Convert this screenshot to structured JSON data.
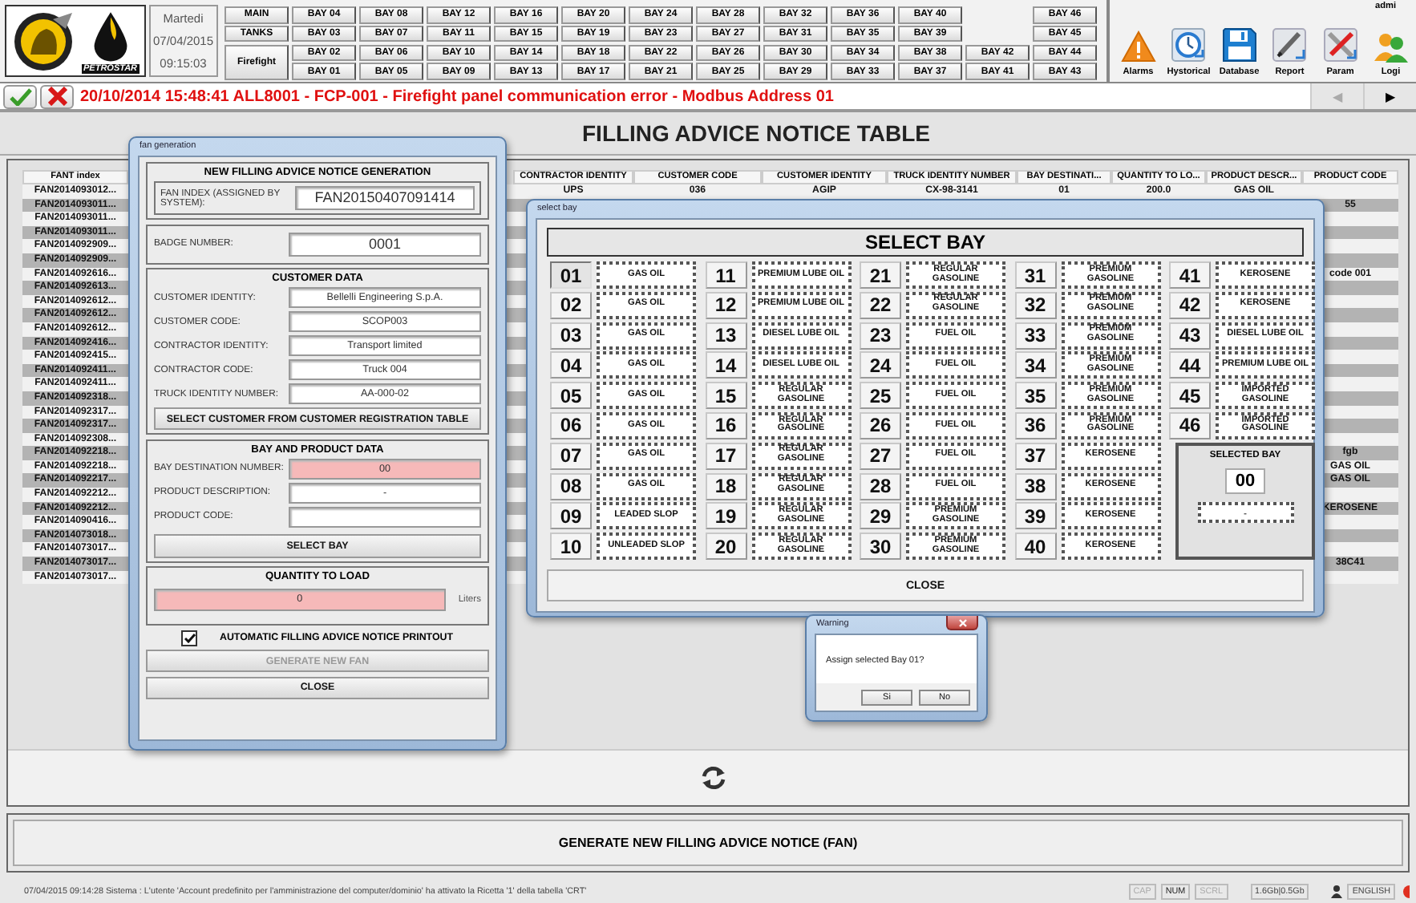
{
  "header": {
    "logo_text": "PETROSTAR",
    "day": "Martedi",
    "date": "07/04/2015",
    "time": "09:15:03",
    "nav_left": [
      "MAIN",
      "TANKS",
      "Firefight"
    ],
    "bay_rows": [
      [
        "BAY 04",
        "BAY 08",
        "BAY 12",
        "BAY 16",
        "BAY 20",
        "BAY 24",
        "BAY 28",
        "BAY 32",
        "BAY 36",
        "BAY 40",
        null,
        "BAY 46"
      ],
      [
        "BAY 03",
        "BAY 07",
        "BAY 11",
        "BAY 15",
        "BAY 19",
        "BAY 23",
        "BAY 27",
        "BAY 31",
        "BAY 35",
        "BAY 39",
        null,
        "BAY 45"
      ],
      [
        "BAY 02",
        "BAY 06",
        "BAY 10",
        "BAY 14",
        "BAY 18",
        "BAY 22",
        "BAY 26",
        "BAY 30",
        "BAY 34",
        "BAY 38",
        "BAY 42",
        "BAY 44"
      ],
      [
        "BAY 01",
        "BAY 05",
        "BAY 09",
        "BAY 13",
        "BAY 17",
        "BAY 21",
        "BAY 25",
        "BAY 29",
        "BAY 33",
        "BAY 37",
        "BAY 41",
        "BAY 43"
      ]
    ],
    "toolbar": [
      {
        "label": "Alarms"
      },
      {
        "label": "Hystorical"
      },
      {
        "label": "Database"
      },
      {
        "label": "Report"
      },
      {
        "label": "Param"
      },
      {
        "label": "Logi",
        "user": "admi"
      }
    ]
  },
  "alarm_bar": {
    "message": "20/10/2014 15:48:41 ALL8001 - FCP-001 - Firefight panel communication error - Modbus Address 01",
    "scroll_buttons": [
      {
        "glyph": "◀",
        "disabled": true
      },
      {
        "glyph": "▶",
        "disabled": false
      }
    ]
  },
  "title": "FILLING ADVICE NOTICE TABLE",
  "table": {
    "columns": [
      "FANT index",
      "CONTRACTOR IDENTITY",
      "CUSTOMER CODE",
      "CUSTOMER IDENTITY",
      "TRUCK IDENTITY NUMBER",
      "BAY DESTINATI...",
      "QUANTITY TO LO...",
      "PRODUCT DESCR...",
      "PRODUCT CODE"
    ],
    "rows": [
      {
        "cells": [
          "FAN2014093012...",
          "UPS",
          "036",
          "AGIP",
          "CX-98-3141",
          "01",
          "200.0",
          "GAS OIL",
          null
        ]
      },
      {
        "cells": [
          "FAN2014093011...",
          null,
          null,
          null,
          null,
          null,
          null,
          null,
          "55"
        ]
      },
      {
        "cells": [
          "FAN2014093011...",
          null,
          null,
          null,
          null,
          null,
          null,
          null,
          null
        ]
      },
      {
        "cells": [
          "FAN2014093011...",
          null,
          null,
          null,
          null,
          null,
          null,
          null,
          null
        ]
      },
      {
        "cells": [
          "FAN2014092909...",
          null,
          null,
          null,
          null,
          null,
          null,
          null,
          null
        ]
      },
      {
        "cells": [
          "FAN2014092909...",
          null,
          null,
          null,
          null,
          null,
          null,
          null,
          null
        ]
      },
      {
        "cells": [
          "FAN2014092616...",
          null,
          null,
          null,
          null,
          null,
          null,
          null,
          "code 001"
        ]
      },
      {
        "cells": [
          "FAN2014092613...",
          null,
          null,
          null,
          null,
          null,
          null,
          null,
          null
        ]
      },
      {
        "cells": [
          "FAN2014092612...",
          null,
          null,
          null,
          null,
          null,
          null,
          null,
          null
        ]
      },
      {
        "cells": [
          "FAN2014092612...",
          null,
          null,
          null,
          null,
          null,
          null,
          null,
          null
        ]
      },
      {
        "cells": [
          "FAN2014092612...",
          null,
          null,
          null,
          null,
          null,
          null,
          null,
          null
        ]
      },
      {
        "cells": [
          "FAN2014092416...",
          null,
          null,
          null,
          null,
          null,
          null,
          null,
          null
        ]
      },
      {
        "cells": [
          "FAN2014092415...",
          null,
          null,
          null,
          null,
          null,
          null,
          null,
          null
        ]
      },
      {
        "cells": [
          "FAN2014092411...",
          null,
          null,
          null,
          null,
          null,
          null,
          null,
          null
        ]
      },
      {
        "cells": [
          "FAN2014092411...",
          null,
          null,
          null,
          null,
          null,
          null,
          null,
          null
        ]
      },
      {
        "cells": [
          "FAN2014092318...",
          null,
          null,
          null,
          null,
          null,
          null,
          null,
          null
        ]
      },
      {
        "cells": [
          "FAN2014092317...",
          null,
          null,
          null,
          null,
          null,
          null,
          null,
          null
        ]
      },
      {
        "cells": [
          "FAN2014092317...",
          null,
          null,
          null,
          null,
          null,
          null,
          null,
          null
        ]
      },
      {
        "cells": [
          "FAN2014092308...",
          null,
          null,
          null,
          null,
          null,
          null,
          null,
          null
        ]
      },
      {
        "cells": [
          "FAN2014092218...",
          null,
          null,
          null,
          null,
          null,
          null,
          null,
          "fgb"
        ]
      },
      {
        "cells": [
          "FAN2014092218...",
          null,
          null,
          null,
          null,
          null,
          null,
          null,
          "GAS OIL"
        ]
      },
      {
        "cells": [
          "FAN2014092217...",
          null,
          null,
          null,
          null,
          null,
          null,
          null,
          "GAS OIL"
        ]
      },
      {
        "cells": [
          "FAN2014092212...",
          null,
          null,
          null,
          null,
          null,
          null,
          null,
          null
        ]
      },
      {
        "cells": [
          "FAN2014092212...",
          null,
          null,
          null,
          null,
          null,
          null,
          null,
          "KEROSENE"
        ]
      },
      {
        "cells": [
          "FAN2014090416...",
          null,
          null,
          null,
          null,
          null,
          null,
          null,
          null
        ]
      },
      {
        "cells": [
          "FAN2014073018...",
          null,
          null,
          null,
          null,
          null,
          null,
          null,
          null
        ]
      },
      {
        "cells": [
          "FAN2014073017...",
          null,
          null,
          null,
          null,
          null,
          null,
          null,
          null
        ]
      },
      {
        "cells": [
          "FAN2014073017...",
          null,
          null,
          null,
          null,
          null,
          null,
          null,
          "38C41"
        ]
      },
      {
        "cells": [
          "FAN2014073017...",
          null,
          null,
          null,
          null,
          null,
          null,
          null,
          null
        ]
      }
    ]
  },
  "generate_button": "GENERATE NEW FILLING ADVICE NOTICE (FAN)",
  "status_bar": {
    "message": "07/04/2015 09:14:28 Sistema : L'utente 'Account predefinito per l'amministrazione del computer/dominio' ha attivato la Ricetta '1' della tabella 'CRT'",
    "indicators": [
      {
        "label": "CAP",
        "on": false
      },
      {
        "label": "NUM",
        "on": true
      },
      {
        "label": "SCRL",
        "on": false
      }
    ],
    "memory": "1.6Gb|0.5Gb",
    "language": "ENGLISH"
  },
  "fan_dialog": {
    "title": "fan generation",
    "heading": "NEW FILLING ADVICE NOTICE GENERATION",
    "fan_index": {
      "label": "FAN INDEX (ASSIGNED BY SYSTEM):",
      "value": "FAN20150407091414"
    },
    "badge": {
      "label": "BADGE NUMBER:",
      "value": "0001"
    },
    "customer": {
      "heading": "CUSTOMER DATA",
      "fields": [
        {
          "label": "CUSTOMER IDENTITY:",
          "value": "Bellelli Engineering S.p.A."
        },
        {
          "label": "CUSTOMER CODE:",
          "value": "SCOP003"
        },
        {
          "label": "CONTRACTOR IDENTITY:",
          "value": "Transport limited"
        },
        {
          "label": "CONTRACTOR CODE:",
          "value": "Truck 004"
        },
        {
          "label": "TRUCK IDENTITY NUMBER:",
          "value": "AA-000-02"
        }
      ],
      "button": "SELECT CUSTOMER FROM CUSTOMER REGISTRATION TABLE"
    },
    "bay_product": {
      "heading": "BAY AND PRODUCT DATA",
      "fields": [
        {
          "label": "BAY DESTINATION NUMBER:",
          "value": "00",
          "invalid": true
        },
        {
          "label": "PRODUCT DESCRIPTION:",
          "value": "-",
          "invalid": false
        },
        {
          "label": "PRODUCT CODE:",
          "invalid": false
        }
      ],
      "button": "SELECT BAY"
    },
    "quantity": {
      "heading": "QUANTITY TO LOAD",
      "value": "0",
      "invalid": true,
      "unit": "Liters"
    },
    "auto_print": {
      "label": "AUTOMATIC FILLING ADVICE NOTICE PRINTOUT",
      "checked": true
    },
    "buttons": [
      {
        "label": "GENERATE NEW FAN",
        "disabled": true
      },
      {
        "label": "CLOSE",
        "disabled": false
      }
    ]
  },
  "bay_dialog": {
    "title": "select bay",
    "heading": "SELECT BAY",
    "bays": [
      {
        "number": "01",
        "product": "GAS OIL",
        "selected": true
      },
      {
        "number": "02",
        "product": "GAS OIL",
        "selected": false
      },
      {
        "number": "03",
        "product": "GAS OIL",
        "selected": false
      },
      {
        "number": "04",
        "product": "GAS OIL",
        "selected": false
      },
      {
        "number": "05",
        "product": "GAS OIL",
        "selected": false
      },
      {
        "number": "06",
        "product": "GAS OIL",
        "selected": false
      },
      {
        "number": "07",
        "product": "GAS OIL",
        "selected": false
      },
      {
        "number": "08",
        "product": "GAS OIL",
        "selected": false
      },
      {
        "number": "09",
        "product": "LEADED SLOP",
        "selected": false
      },
      {
        "number": "10",
        "product": "UNLEADED SLOP",
        "selected": false
      },
      {
        "number": "11",
        "product": "PREMIUM LUBE OIL",
        "selected": false
      },
      {
        "number": "12",
        "product": "PREMIUM LUBE OIL",
        "selected": false
      },
      {
        "number": "13",
        "product": "DIESEL LUBE OIL",
        "selected": false
      },
      {
        "number": "14",
        "product": "DIESEL LUBE OIL",
        "selected": false
      },
      {
        "number": "15",
        "product": "REGULAR GASOLINE",
        "selected": false
      },
      {
        "number": "16",
        "product": "REGULAR GASOLINE",
        "selected": false
      },
      {
        "number": "17",
        "product": "REGULAR GASOLINE",
        "selected": false
      },
      {
        "number": "18",
        "product": "REGULAR GASOLINE",
        "selected": false
      },
      {
        "number": "19",
        "product": "REGULAR GASOLINE",
        "selected": false
      },
      {
        "number": "20",
        "product": "REGULAR GASOLINE",
        "selected": false
      },
      {
        "number": "21",
        "product": "REGULAR GASOLINE",
        "selected": false
      },
      {
        "number": "22",
        "product": "REGULAR GASOLINE",
        "selected": false
      },
      {
        "number": "23",
        "product": "FUEL OIL",
        "selected": false
      },
      {
        "number": "24",
        "product": "FUEL OIL",
        "selected": false
      },
      {
        "number": "25",
        "product": "FUEL OIL",
        "selected": false
      },
      {
        "number": "26",
        "product": "FUEL OIL",
        "selected": false
      },
      {
        "number": "27",
        "product": "FUEL OIL",
        "selected": false
      },
      {
        "number": "28",
        "product": "FUEL OIL",
        "selected": false
      },
      {
        "number": "29",
        "product": "PREMIUM GASOLINE",
        "selected": false
      },
      {
        "number": "30",
        "product": "PREMIUM GASOLINE",
        "selected": false
      },
      {
        "number": "31",
        "product": "PREMIUM GASOLINE",
        "selected": false
      },
      {
        "number": "32",
        "product": "PREMIUM GASOLINE",
        "selected": false
      },
      {
        "number": "33",
        "product": "PREMIUM GASOLINE",
        "selected": false
      },
      {
        "number": "34",
        "product": "PREMIUM GASOLINE",
        "selected": false
      },
      {
        "number": "35",
        "product": "PREMIUM GASOLINE",
        "selected": false
      },
      {
        "number": "36",
        "product": "PREMIUM GASOLINE",
        "selected": false
      },
      {
        "number": "37",
        "product": "KEROSENE",
        "selected": false
      },
      {
        "number": "38",
        "product": "KEROSENE",
        "selected": false
      },
      {
        "number": "39",
        "product": "KEROSENE",
        "selected": false
      },
      {
        "number": "40",
        "product": "KEROSENE",
        "selected": false
      },
      {
        "number": "41",
        "product": "KEROSENE",
        "selected": false
      },
      {
        "number": "42",
        "product": "KEROSENE",
        "selected": false
      },
      {
        "number": "43",
        "product": "DIESEL LUBE OIL",
        "selected": false
      },
      {
        "number": "44",
        "product": "PREMIUM LUBE OIL",
        "selected": false
      },
      {
        "number": "45",
        "product": "IMPORTED GASOLINE",
        "selected": false
      },
      {
        "number": "46",
        "product": "IMPORTED GASOLINE",
        "selected": false
      }
    ],
    "selected_bay": {
      "label": "SELECTED BAY",
      "number": "00",
      "product": "-"
    },
    "close": "CLOSE"
  },
  "warning_dialog": {
    "title": "Warning",
    "message": "Assign selected Bay 01?",
    "buttons": [
      "Si",
      "No"
    ]
  }
}
